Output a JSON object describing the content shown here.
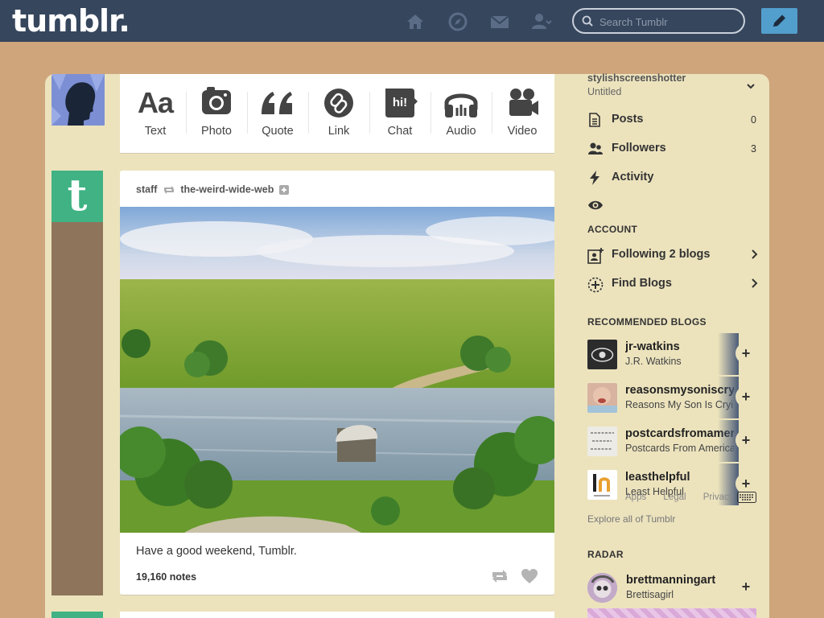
{
  "header": {
    "logo": "tumblr.",
    "search_placeholder": "Search Tumblr",
    "nav_icons": [
      "home-icon",
      "explore-icon",
      "inbox-icon",
      "account-icon"
    ],
    "compose_icon": "pencil-icon",
    "colors": {
      "bar": "#36465d",
      "compose": "#529ecc",
      "page": "#cfa57c",
      "container": "#ece3bd",
      "accent_green": "#40b283"
    }
  },
  "composer": {
    "types": [
      {
        "label": "Text",
        "icon": "text-icon"
      },
      {
        "label": "Photo",
        "icon": "camera-icon"
      },
      {
        "label": "Quote",
        "icon": "quote-icon"
      },
      {
        "label": "Link",
        "icon": "link-icon"
      },
      {
        "label": "Chat",
        "icon": "chat-icon"
      },
      {
        "label": "Audio",
        "icon": "headphones-icon"
      },
      {
        "label": "Video",
        "icon": "video-camera-icon"
      }
    ],
    "text_glyph": "Aa",
    "chat_glyph": "hi!"
  },
  "post": {
    "author": "staff",
    "reblogged_from": "the-weird-wide-web",
    "caption": "Have a good weekend, Tumblr.",
    "notes": "19,160 notes",
    "avatar_letter": "t"
  },
  "sidebar": {
    "username": "stylishscreenshotter",
    "blog_title": "Untitled",
    "stats": [
      {
        "label": "Posts",
        "count": "0",
        "icon": "posts-icon"
      },
      {
        "label": "Followers",
        "count": "3",
        "icon": "followers-icon"
      },
      {
        "label": "Activity",
        "count": "",
        "icon": "activity-icon"
      }
    ],
    "eye_icon": "eye-icon",
    "account_heading": "ACCOUNT",
    "account_links": [
      {
        "label": "Following 2 blogs",
        "icon": "following-icon"
      },
      {
        "label": "Find Blogs",
        "icon": "find-blogs-icon"
      }
    ],
    "recommended_heading": "RECOMMENDED BLOGS",
    "recommended": [
      {
        "name": "jr-watkins",
        "title": "J.R. Watkins"
      },
      {
        "name": "reasonsmysoniscrying",
        "title": "Reasons My Son Is Crying"
      },
      {
        "name": "postcardsfromamerica",
        "title": "Postcards From America"
      },
      {
        "name": "leasthelpful",
        "title": "Least Helpful"
      }
    ],
    "footer_links": [
      "Apps",
      "Legal",
      "Privacy"
    ],
    "explore": "Explore all of Tumblr",
    "radar_heading": "RADAR",
    "radar": {
      "name": "brettmanningart",
      "title": "Brettisagirl"
    },
    "plus_glyph": "+"
  }
}
